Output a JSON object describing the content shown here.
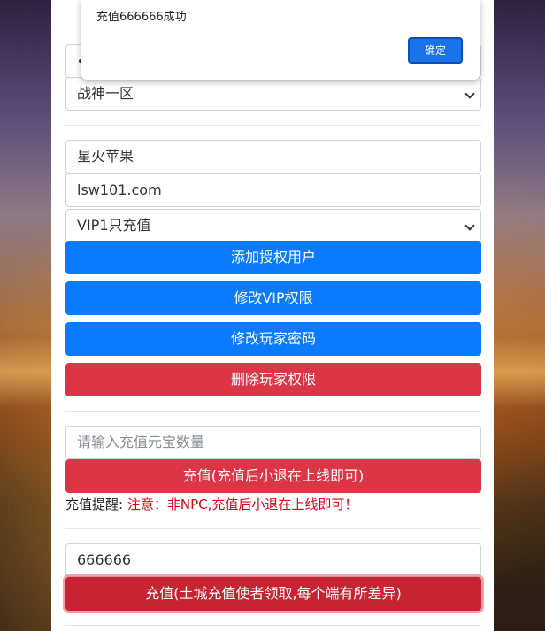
{
  "dialog": {
    "message": "充值666666成功",
    "ok_label": "确定"
  },
  "server_select": {
    "value": "战神一区"
  },
  "auth": {
    "player_name": "星火苹果",
    "account": "lsw101.com",
    "vip_select": "VIP1只充值",
    "add_auth_label": "添加授权用户",
    "modify_vip_label": "修改VIP权限",
    "modify_password_label": "修改玩家密码",
    "delete_auth_label": "删除玩家权限"
  },
  "recharge": {
    "ingot_placeholder": "请输入充值元宝数量",
    "recharge_label": "充值(充值后小退在上线即可)",
    "notice_label": "充值提醒:",
    "notice_text": "注意：非NPC,充值后小退在上线即可！"
  },
  "recharge2": {
    "amount_value": "666666",
    "recharge_label": "充值(土城充值使者领取,每个端有所差异)"
  }
}
